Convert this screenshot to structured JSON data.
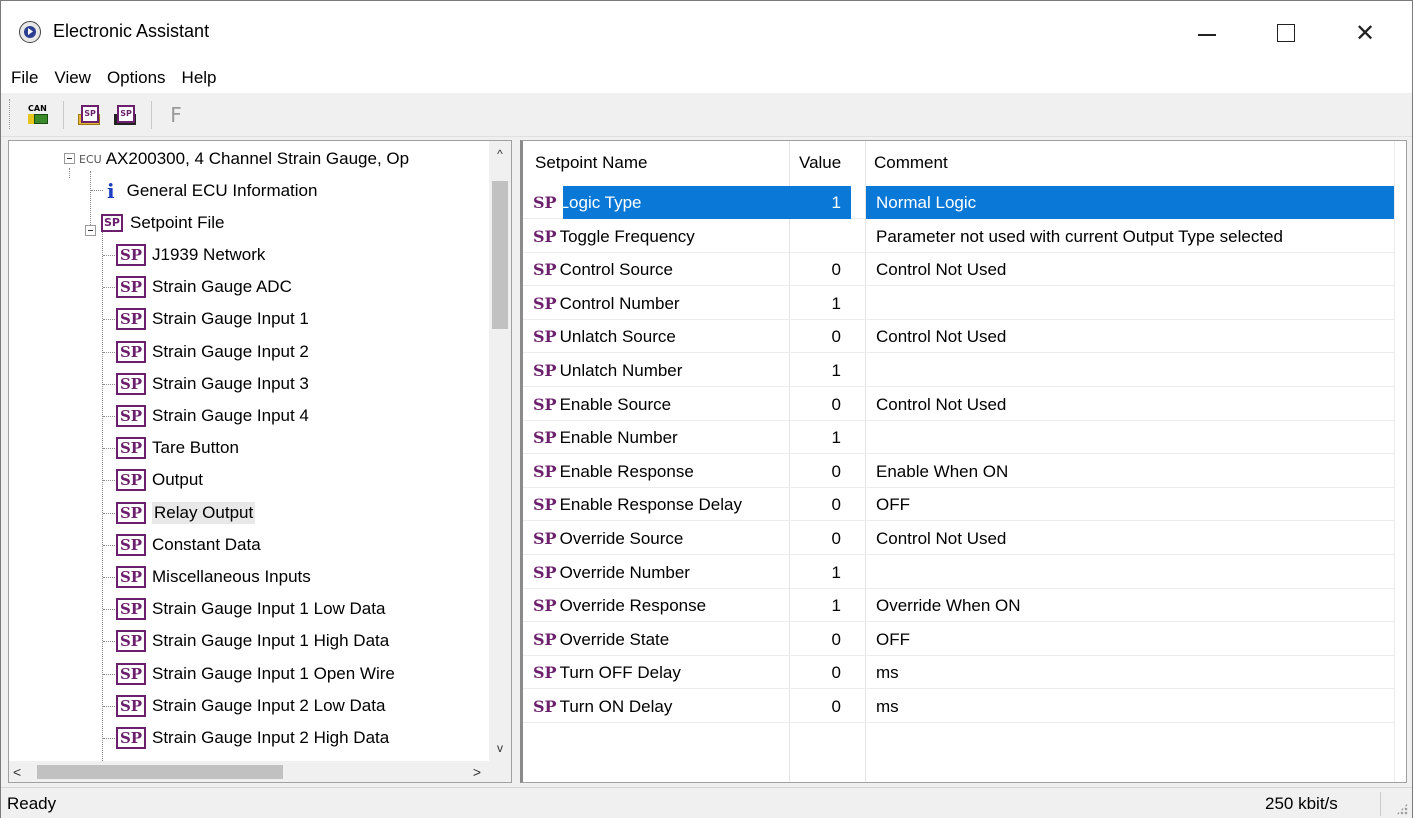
{
  "window": {
    "title": "Electronic Assistant",
    "controls": {
      "minimize": "—",
      "maximize": "☐",
      "close": "✕"
    }
  },
  "menu": [
    "File",
    "View",
    "Options",
    "Help"
  ],
  "toolbar": {
    "buttons": [
      {
        "icon": "can-connect-icon",
        "label": "CAN"
      },
      {
        "icon": "open-setpoint-icon",
        "label": "SP"
      },
      {
        "icon": "save-setpoint-icon",
        "label": "SP"
      },
      {
        "icon": "flash-icon",
        "label": "F"
      }
    ]
  },
  "tree": {
    "root": {
      "tag": "ECU",
      "label": "AX200300, 4 Channel Strain Gauge, Op"
    },
    "general_info": {
      "icon": "i",
      "label": "General ECU Information"
    },
    "setpoint_file": {
      "icon": "SP",
      "label": "Setpoint File"
    },
    "sp_icon": "SP",
    "items": [
      "J1939 Network",
      "Strain Gauge ADC",
      "Strain Gauge Input 1",
      "Strain Gauge Input 2",
      "Strain Gauge Input 3",
      "Strain Gauge Input 4",
      "Tare Button",
      "Output",
      "Relay Output",
      "Constant Data",
      "Miscellaneous Inputs",
      "Strain Gauge Input 1 Low Data",
      "Strain Gauge Input 1 High Data",
      "Strain Gauge Input 1 Open Wire",
      "Strain Gauge Input 2 Low Data",
      "Strain Gauge Input 2 High Data"
    ],
    "selected_item": "Relay Output",
    "scroll": {
      "up": "^",
      "down": "v",
      "left": "<",
      "right": ">"
    }
  },
  "table": {
    "headers": {
      "name": "Setpoint Name",
      "value": "Value",
      "comment": "Comment"
    },
    "sp_tag": "SP",
    "rows": [
      {
        "name": "Logic Type",
        "value": "1",
        "comment": "Normal Logic",
        "selected": true
      },
      {
        "name": "Toggle Frequency",
        "value": "",
        "comment": "Parameter not used with current Output Type selected"
      },
      {
        "name": "Control Source",
        "value": "0",
        "comment": "Control Not Used"
      },
      {
        "name": "Control Number",
        "value": "1",
        "comment": ""
      },
      {
        "name": "Unlatch Source",
        "value": "0",
        "comment": "Control Not Used"
      },
      {
        "name": "Unlatch Number",
        "value": "1",
        "comment": ""
      },
      {
        "name": "Enable Source",
        "value": "0",
        "comment": "Control Not Used"
      },
      {
        "name": "Enable Number",
        "value": "1",
        "comment": ""
      },
      {
        "name": "Enable Response",
        "value": "0",
        "comment": "Enable When ON"
      },
      {
        "name": "Enable Response Delay",
        "value": "0",
        "comment": "OFF"
      },
      {
        "name": "Override Source",
        "value": "0",
        "comment": "Control Not Used"
      },
      {
        "name": "Override Number",
        "value": "1",
        "comment": ""
      },
      {
        "name": "Override Response",
        "value": "1",
        "comment": "Override When ON"
      },
      {
        "name": "Override State",
        "value": "0",
        "comment": "OFF"
      },
      {
        "name": "Turn OFF Delay",
        "value": "0",
        "comment": "ms"
      },
      {
        "name": "Turn ON Delay",
        "value": "0",
        "comment": "ms"
      }
    ]
  },
  "status": {
    "text": "Ready",
    "bitrate": "250 kbit/s"
  },
  "colors": {
    "selection": "#0a78d7",
    "sp_purple": "#6c1f6c",
    "info_blue": "#1b3fbf"
  }
}
